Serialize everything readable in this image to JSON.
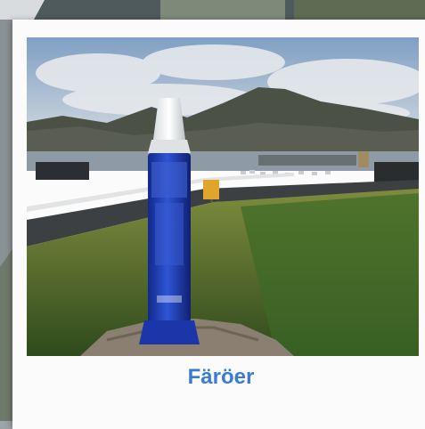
{
  "caption": "Färöer",
  "colors": {
    "caption": "#3a7bd5",
    "card": "#fbfbfb",
    "bottle": "#1f3fb0"
  },
  "photo": {
    "subject": "blue-tube-on-rock",
    "scene": "harbor-mountains-landscape"
  }
}
